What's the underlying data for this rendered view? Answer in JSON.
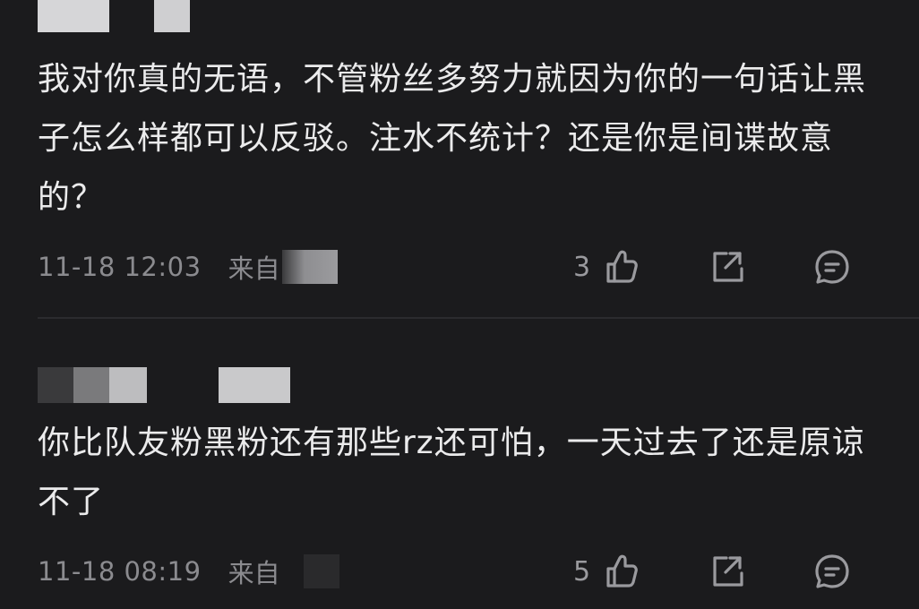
{
  "comments": [
    {
      "text": "我对你真的无语，不管粉丝多努力就因为你的一句话让黑子怎么样都可以反驳。注水不统计？还是你是间谍故意的？",
      "time": "11-18 12:03",
      "from_label": "来自",
      "likes": "3"
    },
    {
      "text": "你比队友粉黑粉还有那些rz还可怕，一天过去了还是原谅不了",
      "time": "11-18 08:19",
      "from_label": "来自",
      "likes": "5"
    }
  ],
  "icons": {
    "like": "thumbs-up-icon",
    "share": "share-icon",
    "reply": "comment-icon"
  },
  "colors": {
    "background": "#1b1b1d",
    "text": "#ebebec",
    "meta": "#8b8b8f",
    "icon": "#9a9a9e"
  }
}
